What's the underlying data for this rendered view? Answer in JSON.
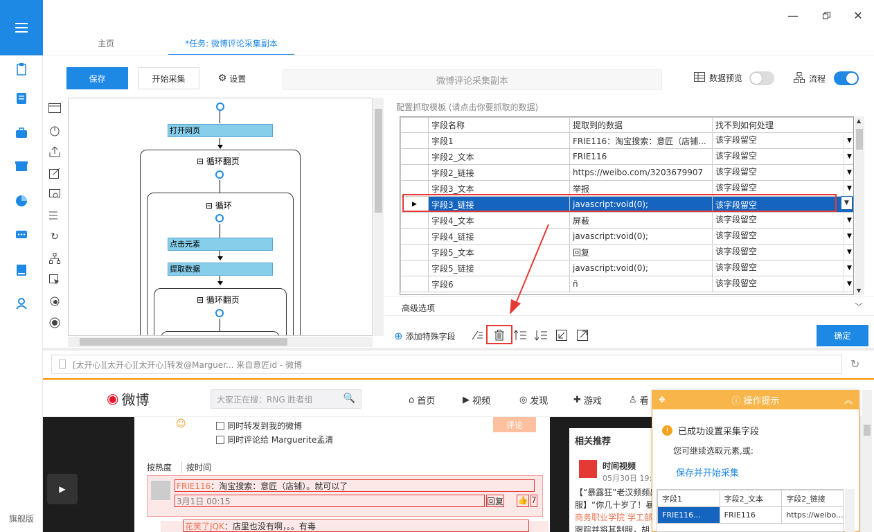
{
  "app": {
    "flagship_label": "旗舰版"
  },
  "tabs": {
    "home": "主页",
    "task": "*任务: 微博评论采集副本"
  },
  "toolbar": {
    "save": "保存",
    "start": "开始采集",
    "settings": "设置",
    "task_name": "微博评论采集副本",
    "preview": "数据预览",
    "flow": "流程",
    "preview_on": false,
    "flow_on": true
  },
  "flow": {
    "open_page": "打开网页",
    "loop_page1": "循环翻页",
    "loop": "循环",
    "click_element": "点击元素",
    "extract_data": "提取数据",
    "loop_page2": "循环翻页"
  },
  "config": {
    "title": "配置抓取模板 (请点击你要抓取的数据)",
    "columns": [
      "字段名称",
      "提取到的数据",
      "找不到如何处理"
    ],
    "rows": [
      {
        "name": "字段1",
        "data": "FRIE116：淘宝搜索：意匠（店铺...",
        "handle": "该字段留空"
      },
      {
        "name": "字段2_文本",
        "data": "FRIE116",
        "handle": "该字段留空"
      },
      {
        "name": "字段2_链接",
        "data": "https://weibo.com/3203679907",
        "handle": "该字段留空"
      },
      {
        "name": "字段3_文本",
        "data": "举报",
        "handle": "该字段留空"
      },
      {
        "name": "字段3_链接",
        "data": "javascript:void(0);",
        "handle": "该字段留空"
      },
      {
        "name": "字段4_文本",
        "data": "屏蔽",
        "handle": "该字段留空"
      },
      {
        "name": "字段4_链接",
        "data": "javascript:void(0);",
        "handle": "该字段留空"
      },
      {
        "name": "字段5_文本",
        "data": "回复",
        "handle": "该字段留空"
      },
      {
        "name": "字段5_链接",
        "data": "javascript:void(0);",
        "handle": "该字段留空"
      },
      {
        "name": "字段6",
        "data": "ñ",
        "handle": "该字段留空"
      }
    ],
    "selected_index": 4,
    "advanced": "高级选项",
    "add_field": "添加特殊字段",
    "ok": "确定"
  },
  "browser": {
    "url": "[太开心][太开心][太开心]转发@Marguer... 来自意匠id - 微博"
  },
  "weibo": {
    "logo": "微博",
    "search_placeholder": "大家正在搜：RNG 胜者组",
    "nav": [
      "首页",
      "视频",
      "发现",
      "游戏",
      "看"
    ],
    "forward_opt": "同时转发到我的微博",
    "comment_opt": "同时评论给 Marguerite孟清",
    "comment_btn": "评论",
    "sort_hot": "按热度",
    "sort_time": "按时间",
    "c1_user": "FRIE116",
    "c1_text": "：淘宝搜索：意匠（店铺）。就可以了",
    "c1_time": "3月1日 00:15",
    "c1_reply": "回复",
    "c1_likes": "7",
    "c2_user": "花笑了JQK",
    "c2_text": "：店里也没有啊，。。有毒",
    "related_title": "相关推荐",
    "rel_source": "时间视频",
    "rel_date": "05月30日 19:",
    "rel_text1": "【“暴露狂”老汉频频出",
    "rel_text2": "服】“你几十岁了！暴",
    "rel_text3": "商务职业学院 学工部",
    "rel_text4": "跟踪并将其制服，胡"
  },
  "tip": {
    "title": "操作提示",
    "success": "已成功设置采集字段",
    "continue": "您可继续选取元素,或:",
    "save_start": "保存并开始采集",
    "mini_headers": [
      "字段1",
      "字段2_文本",
      "字段2_链接"
    ],
    "mini_row": [
      "FRIE116...",
      "FRIE116",
      "https://weibo..."
    ]
  },
  "colors": {
    "accent": "#1e88e5",
    "highlight": "#e53935",
    "flow_node": "#87ceeb",
    "tip": "#f7b54a"
  }
}
